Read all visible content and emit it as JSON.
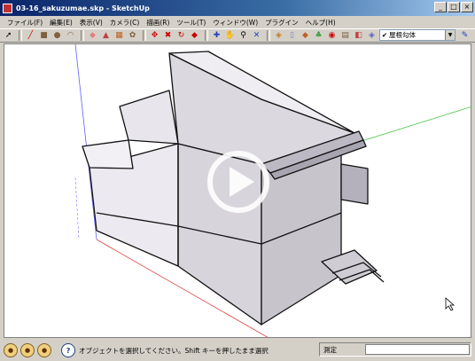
{
  "window": {
    "title": "03-16_sakuzumae.skp - SketchUp",
    "minimize_icon": "_",
    "maximize_icon": "□",
    "close_icon": "×"
  },
  "menu": {
    "items": [
      "ファイル(F)",
      "編集(E)",
      "表示(V)",
      "カメラ(C)",
      "描画(R)",
      "ツール(T)",
      "ウィンドウ(W)",
      "プラグイン",
      "ヘルプ(H)"
    ]
  },
  "toolbar": {
    "tools": [
      "select-tool",
      "line-tool",
      "rectangle-tool",
      "circle-tool",
      "arc-tool",
      "eraser-tool",
      "paint-bucket-tool",
      "push-pull-tool",
      "move-tool",
      "rotate-tool",
      "follow-me-tool",
      "scale-tool",
      "offset-tool",
      "tape-measure-tool",
      "dimension-tool",
      "protractor-tool",
      "text-tool",
      "axes-tool",
      "3d-text-tool",
      "orbit-tool",
      "pan-tool",
      "zoom-tool",
      "zoom-window-tool",
      "zoom-extents-tool",
      "previous-view-tool",
      "component-tool",
      "paint-tool",
      "walk-tool",
      "look-around-tool",
      "section-tool"
    ],
    "scene_check": "✔",
    "scene_name": "屋根勾体"
  },
  "status": {
    "message": "オブジェクトを選択してください。Shift キーを押したまま選択",
    "measure_label": "測定",
    "help_icon": "?"
  }
}
